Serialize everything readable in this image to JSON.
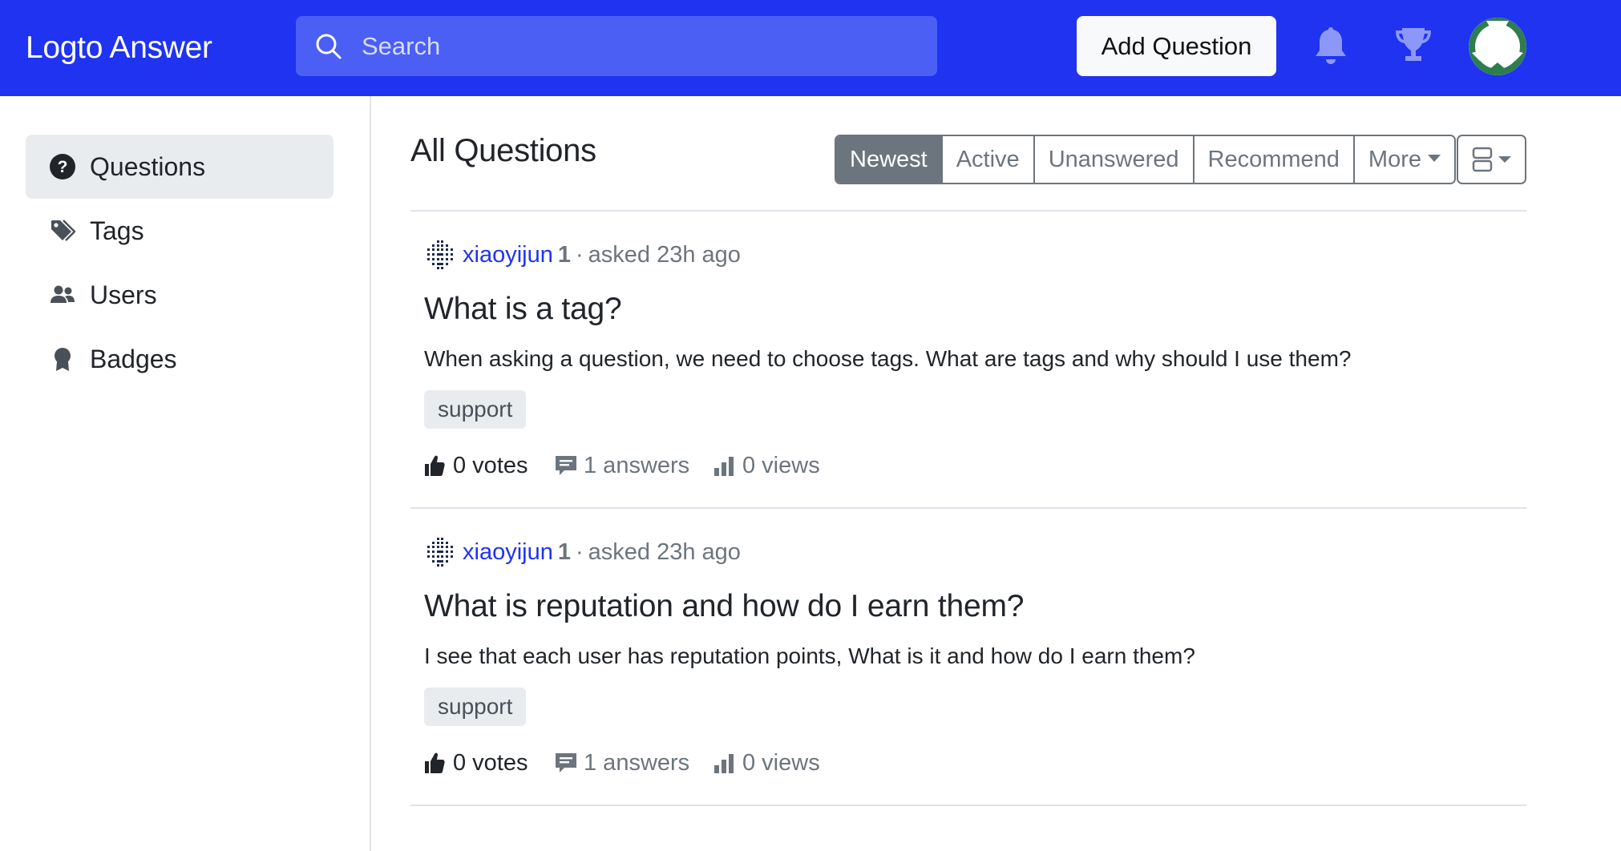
{
  "header": {
    "brand": "Logto Answer",
    "search_placeholder": "Search",
    "add_question_label": "Add Question"
  },
  "sidebar": {
    "items": [
      {
        "label": "Questions",
        "icon": "question-circle-icon",
        "active": true
      },
      {
        "label": "Tags",
        "icon": "tags-icon",
        "active": false
      },
      {
        "label": "Users",
        "icon": "users-icon",
        "active": false
      },
      {
        "label": "Badges",
        "icon": "award-icon",
        "active": false
      }
    ]
  },
  "main": {
    "title": "All Questions",
    "sort_tabs": [
      {
        "label": "Newest",
        "active": true
      },
      {
        "label": "Active",
        "active": false
      },
      {
        "label": "Unanswered",
        "active": false
      },
      {
        "label": "Recommend",
        "active": false
      },
      {
        "label": "More",
        "active": false
      }
    ],
    "questions": [
      {
        "author": "xiaoyijun",
        "reputation": "1",
        "asked": "asked 23h ago",
        "title": "What is a tag?",
        "excerpt": "When asking a question, we need to choose tags. What are tags and why should I use them?",
        "tags": [
          "support"
        ],
        "votes": "0 votes",
        "answers": "1 answers",
        "views": "0 views"
      },
      {
        "author": "xiaoyijun",
        "reputation": "1",
        "asked": "asked 23h ago",
        "title": "What is reputation and how do I earn them?",
        "excerpt": "I see that each user has reputation points, What is it and how do I earn them?",
        "tags": [
          "support"
        ],
        "votes": "0 votes",
        "answers": "1 answers",
        "views": "0 views"
      }
    ]
  },
  "colors": {
    "navbar": "#1f33f1",
    "search_bg": "#4b5ff4",
    "link": "#1f33f1",
    "secondary": "#6c757d"
  }
}
